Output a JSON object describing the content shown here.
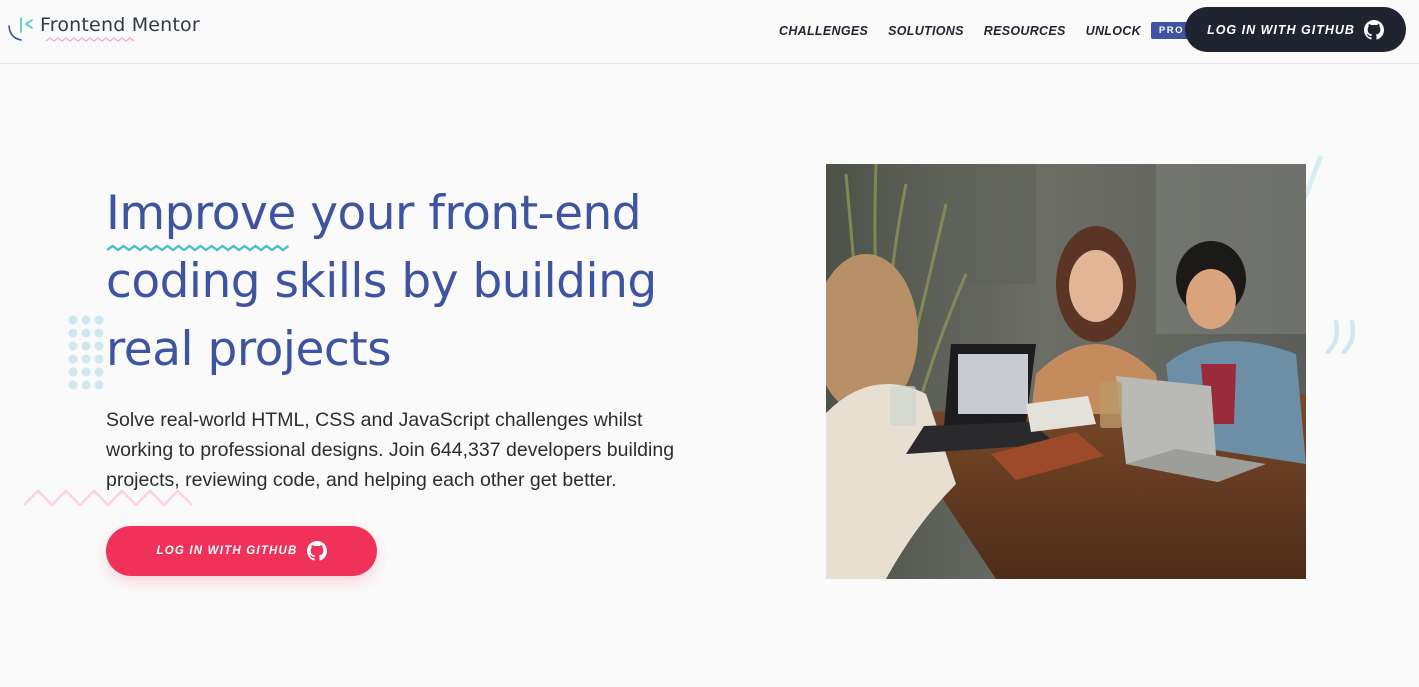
{
  "brand": {
    "name": "Frontend Mentor"
  },
  "nav": {
    "links": [
      "CHALLENGES",
      "SOLUTIONS",
      "RESOURCES"
    ],
    "unlock": "UNLOCK",
    "pro_badge": "PRO"
  },
  "header_button": {
    "label": "LOG IN WITH GITHUB",
    "icon": "github-icon"
  },
  "hero": {
    "title_line1": "Improve your front-end",
    "title_line2": "coding skills by building",
    "title_line3": "real projects",
    "description_line1": "Solve real-world HTML, CSS and JavaScript challenges whilst",
    "description_line2": "working to professional designs. Join 644,337 developers building",
    "description_line3": "projects, reviewing code, and helping each other get better.",
    "button_label": "LOG IN WITH GITHUB",
    "button_icon": "github-icon"
  },
  "colors": {
    "primary_blue": "#3e54a3",
    "accent_pink": "#f0325b",
    "dark": "#1f2430",
    "teal": "#4fbfd0"
  }
}
